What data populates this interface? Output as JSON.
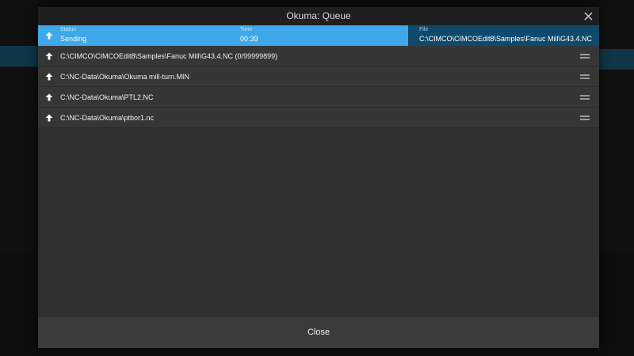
{
  "dialog": {
    "title": "Okuma: Queue",
    "close_icon": "close-icon",
    "close_button_label": "Close"
  },
  "active_job": {
    "status_caption": "Status",
    "status_value": "Sending",
    "time_caption": "Time",
    "time_value": "00:39",
    "file_caption": "File",
    "file_value": "C:\\CIMCO\\CIMCOEdit8\\Samples\\Fanuc Mill\\G43.4.NC",
    "icon": "upload-arrow-icon"
  },
  "queue": {
    "items": [
      {
        "path": "C:\\CIMCO\\CIMCOEdit8\\Samples\\Fanuc Mill\\G43.4.NC (0/99999899)"
      },
      {
        "path": "C:\\NC-Data\\Okuma\\Okuma mill-turn.MIN"
      },
      {
        "path": "C:\\NC-Data\\Okuma\\PTL2.NC"
      },
      {
        "path": "C:\\NC-Data\\Okuma\\ptbor1.nc"
      }
    ],
    "item_icon": "upload-arrow-icon",
    "handle_icon": "drag-handle-icon"
  },
  "colors": {
    "active_left": "#3ea8e9",
    "active_right": "#0f4a6c",
    "dialog_bg": "#303030",
    "title_bg": "#1f1f1f"
  }
}
